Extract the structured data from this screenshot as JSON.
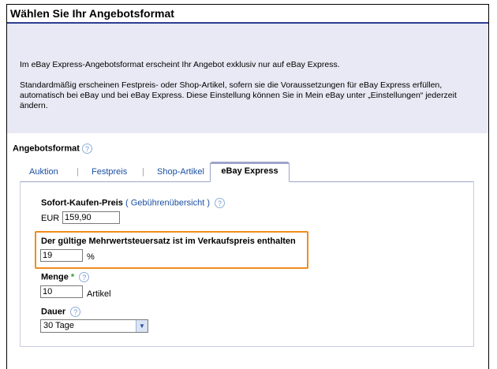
{
  "header": {
    "title": "Wählen Sie Ihr Angebotsformat"
  },
  "info": {
    "p1": "Im eBay Express-Angebotsformat erscheint Ihr Angebot exklusiv nur auf eBay Express.",
    "p2": "Standardmäßig erscheinen Festpreis- oder Shop-Artikel, sofern sie die Voraussetzungen für eBay Express erfüllen, automatisch bei eBay und bei eBay Express. Diese Einstellung können Sie in Mein eBay unter „Einstellungen“ jederzeit ändern."
  },
  "format": {
    "label": "Angebotsformat",
    "tabs": [
      {
        "label": "Auktion"
      },
      {
        "label": "Festpreis"
      },
      {
        "label": "Shop-Artikel"
      },
      {
        "label": "eBay Express"
      }
    ],
    "active_tab": "eBay Express"
  },
  "fields": {
    "price_label": "Sofort-Kaufen-Preis",
    "fee_paren_open": "(",
    "fee_link": "Gebührenübersicht",
    "fee_paren_close": ")",
    "currency": "EUR",
    "price_value": "159,90",
    "vat_label": "Der gültige Mehrwertsteuersatz ist im Verkaufspreis enthalten",
    "vat_value": "19",
    "vat_unit": "%",
    "quantity_label": "Menge",
    "required_marker": "*",
    "quantity_value": "10",
    "quantity_unit": "Artikel",
    "duration_label": "Dauer",
    "duration_value": "30 Tage"
  },
  "icons": {
    "help": "?",
    "dropdown": "▼"
  },
  "colors": {
    "header_rule": "#2a3d8f",
    "info_bg": "#e8e9f4",
    "highlight": "#f08c1c",
    "link": "#1a4fa3",
    "required": "#2e9a2e"
  }
}
